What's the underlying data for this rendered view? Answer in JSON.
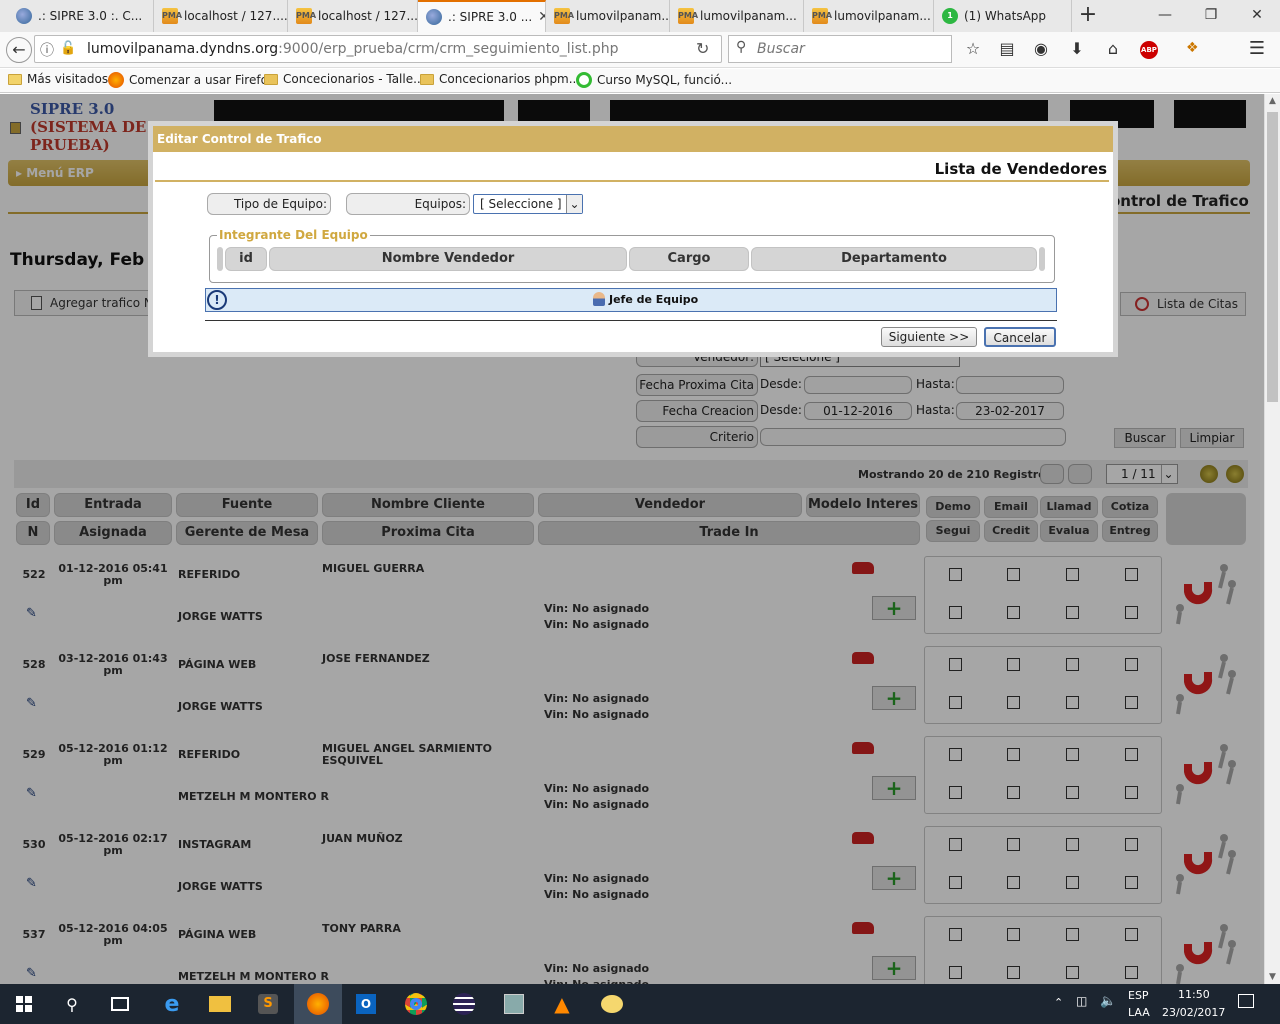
{
  "browser": {
    "tabs": [
      {
        "title": ".: SIPRE 3.0 :. C...",
        "icon": "globe-icon"
      },
      {
        "title": "localhost / 127....",
        "icon": "phpmyadmin-icon"
      },
      {
        "title": "localhost / 127....",
        "icon": "phpmyadmin-icon"
      },
      {
        "title": ".: SIPRE 3.0 ...",
        "icon": "globe-icon",
        "active": true
      },
      {
        "title": "lumovilpanam...",
        "icon": "phpmyadmin-icon"
      },
      {
        "title": "lumovilpanam...",
        "icon": "phpmyadmin-icon"
      },
      {
        "title": "lumovilpanam...",
        "icon": "phpmyadmin-icon"
      },
      {
        "title": "(1) WhatsApp",
        "icon": "whatsapp-icon",
        "badge": "1"
      }
    ],
    "url_host": "lumovilpanama.dyndns.org",
    "url_path": ":9000/erp_prueba/crm/crm_seguimiento_list.php",
    "search_placeholder": "Buscar",
    "bookmarks": [
      "Más visitados",
      "Comenzar a usar Firefox",
      "Concecionarios - Talle...",
      "Concecionarios phpm...",
      "Curso MySQL, funció..."
    ]
  },
  "app": {
    "logo_line1": "SIPRE 3.0",
    "logo_line2": "(SISTEMA DE",
    "logo_line3": "PRUEBA)",
    "menu_label": "Menú ERP",
    "section_title": "ontrol de Trafico",
    "date_heading": "Thursday, Feb",
    "add_button": "Agregar trafico N",
    "citas_button": "Lista de Citas"
  },
  "filters": {
    "vendedor_label": "Vendedor:",
    "vendedor_value": "[ Selecione ]",
    "fecha_proxima_label": "Fecha Proxima Cita",
    "fecha_creacion_label": "Fecha Creacion",
    "desde": "Desde:",
    "hasta": "Hasta:",
    "creacion_desde": "01-12-2016",
    "creacion_hasta": "23-02-2017",
    "criterio_label": "Criterio",
    "buscar": "Buscar",
    "limpiar": "Limpiar"
  },
  "pager": {
    "summary": "Mostrando 20 de 210 Registros",
    "page": "1 / 11"
  },
  "table": {
    "headers_row1": [
      "Id",
      "Entrada",
      "Fuente",
      "Nombre Cliente",
      "Vendedor",
      "Modelo Interes"
    ],
    "headers_row2": [
      "N",
      "Asignada",
      "Gerente de Mesa",
      "Proxima Cita",
      "Trade In"
    ],
    "status_row1": [
      "Demo",
      "Email",
      "Llamad",
      "Cotiza"
    ],
    "status_row2": [
      "Segui",
      "Credit",
      "Evalua",
      "Entreg"
    ],
    "vin_text": "Vin: No asignado",
    "rows": [
      {
        "id": "522",
        "entrada": "01-12-2016 05:41",
        "ampm": "pm",
        "fuente": "REFERIDO",
        "cliente": "MIGUEL GUERRA",
        "cliente2": "",
        "gerente": "JORGE WATTS"
      },
      {
        "id": "528",
        "entrada": "03-12-2016 01:43",
        "ampm": "pm",
        "fuente": "PÁGINA WEB",
        "cliente": "JOSE FERNANDEZ",
        "cliente2": "",
        "gerente": "JORGE WATTS"
      },
      {
        "id": "529",
        "entrada": "05-12-2016 01:12",
        "ampm": "pm",
        "fuente": "REFERIDO",
        "cliente": "MIGUEL ANGEL SARMIENTO",
        "cliente2": "ESQUIVEL",
        "gerente": "METZELH M MONTERO R"
      },
      {
        "id": "530",
        "entrada": "05-12-2016 02:17",
        "ampm": "pm",
        "fuente": "INSTAGRAM",
        "cliente": "JUAN MUÑOZ",
        "cliente2": "",
        "gerente": "JORGE WATTS"
      },
      {
        "id": "537",
        "entrada": "05-12-2016 04:05",
        "ampm": "pm",
        "fuente": "PÁGINA WEB",
        "cliente": "TONY PARRA",
        "cliente2": "",
        "gerente": "METZELH M MONTERO R"
      }
    ]
  },
  "modal": {
    "title": "Editar Control de Trafico",
    "heading": "Lista de Vendedores",
    "tipo_equipo_label": "Tipo de Equipo:",
    "equipos_label": "Equipos:",
    "equipos_value": "[ Seleccione ]",
    "fieldset_legend": "Integrante Del Equipo",
    "columns": [
      "id",
      "Nombre Vendedor",
      "Cargo",
      "Departamento"
    ],
    "jefe_label": "Jefe de Equipo",
    "next_button": "Siguiente >>",
    "cancel_button": "Cancelar"
  },
  "taskbar": {
    "lang1": "ESP",
    "lang2": "LAA",
    "time": "11:50",
    "date": "23/02/2017"
  },
  "colors": {
    "modal_title_bg": "#d1b163",
    "legend_text": "#d0a840",
    "logo_text": "#3c5aa8",
    "menu_bar": "#c9a640"
  }
}
